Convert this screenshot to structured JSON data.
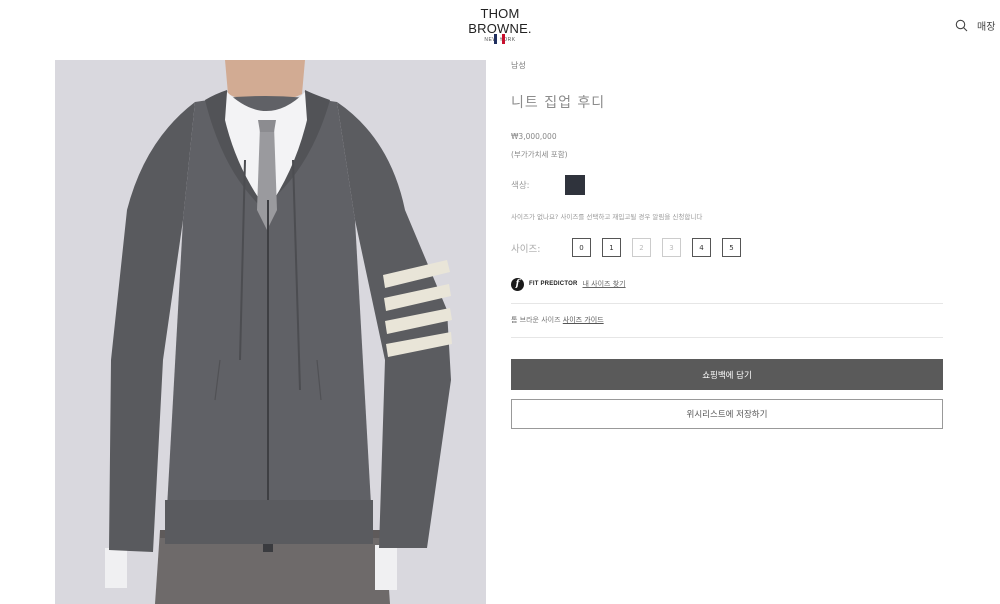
{
  "brand": {
    "name": "THOM BROWNE.",
    "sub": "NEW YORK",
    "flag_colors": [
      "#1f2e5e",
      "#c7102e"
    ]
  },
  "header": {
    "store_label": "매장",
    "search_icon": "search-icon"
  },
  "product": {
    "category": "남성",
    "title": "니트 집업 후디",
    "price": "₩3,000,000",
    "tax_note": "(부가가치세 포함)",
    "color_label": "색상:",
    "color_swatch": "#2f333c",
    "size_notice": "사이즈가 없나요? 사이즈를 선택하고 재입고될 경우 알림을 신청합니다",
    "size_label": "사이즈:",
    "sizes": [
      {
        "label": "0",
        "available": true
      },
      {
        "label": "1",
        "available": true
      },
      {
        "label": "2",
        "available": false
      },
      {
        "label": "3",
        "available": false
      },
      {
        "label": "4",
        "available": true
      },
      {
        "label": "5",
        "available": true
      }
    ],
    "fit_predictor": {
      "icon_letter": "f",
      "brand": "FIT PREDICTOR",
      "link": "내 사이즈 찾기"
    },
    "size_guide": {
      "text": "톰 브라운 사이즈",
      "link": "사이즈 가이드"
    },
    "add_to_bag": "쇼핑백에 담기",
    "wishlist": "위시리스트에 저장하기"
  },
  "colors": {
    "cart_button": "#5a5a5a",
    "knit_grey": "#5b5c60",
    "stripe_white": "#e9e5d8"
  }
}
